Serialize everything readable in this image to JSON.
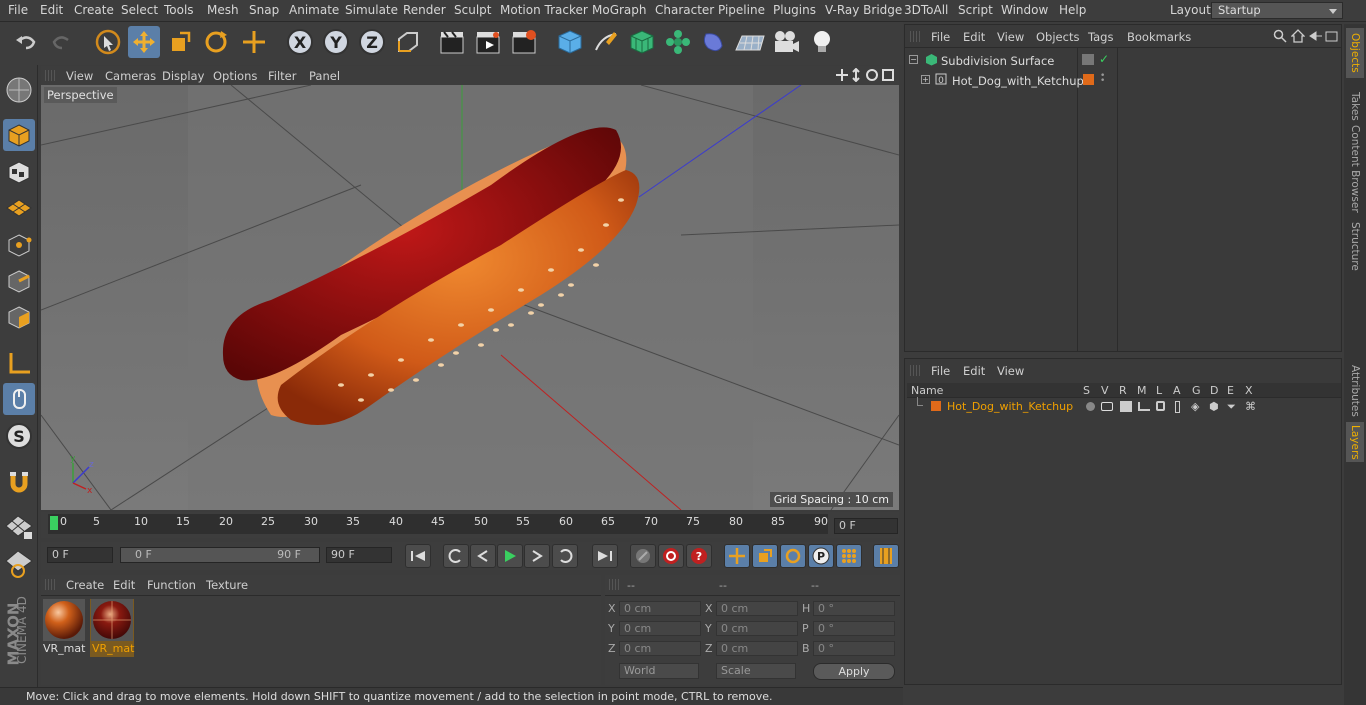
{
  "menu": [
    "File",
    "Edit",
    "Create",
    "Select",
    "Tools",
    "Mesh",
    "Snap",
    "Animate",
    "Simulate",
    "Render",
    "Sculpt",
    "Motion Tracker",
    "MoGraph",
    "Character",
    "Pipeline",
    "Plugins",
    "V-Ray Bridge",
    "3DToAll",
    "Script",
    "Window",
    "Help"
  ],
  "layout": {
    "label": "Layout:",
    "value": "Startup"
  },
  "viewport": {
    "menu": [
      "View",
      "Cameras",
      "Display",
      "Options",
      "Filter",
      "Panel"
    ],
    "label": "Perspective",
    "grid_spacing": "Grid Spacing : 10 cm"
  },
  "timeline": {
    "ticks": [
      "0",
      "5",
      "10",
      "15",
      "20",
      "25",
      "30",
      "35",
      "40",
      "45",
      "50",
      "55",
      "60",
      "65",
      "70",
      "75",
      "80",
      "85",
      "90"
    ],
    "current_frame": "0 F",
    "start_field": "0 F",
    "range_start": "0 F",
    "range_end": "90 F",
    "end_field": "90 F"
  },
  "materials": {
    "menu": [
      "Create",
      "Edit",
      "Function",
      "Texture"
    ],
    "items": [
      {
        "label": "VR_mat",
        "selected": false
      },
      {
        "label": "VR_mat",
        "selected": true
      }
    ]
  },
  "coords": {
    "headers": [
      "--",
      "--",
      "--"
    ],
    "rows": [
      {
        "l1": "X",
        "v1": "0 cm",
        "l2": "X",
        "v2": "0 cm",
        "l3": "H",
        "v3": "0 °"
      },
      {
        "l1": "Y",
        "v1": "0 cm",
        "l2": "Y",
        "v2": "0 cm",
        "l3": "P",
        "v3": "0 °"
      },
      {
        "l1": "Z",
        "v1": "0 cm",
        "l2": "Z",
        "v2": "0 cm",
        "l3": "B",
        "v3": "0 °"
      }
    ],
    "world": "World",
    "scale": "Scale",
    "apply": "Apply"
  },
  "status": "Move: Click and drag to move elements. Hold down SHIFT to quantize movement / add to the selection in point mode, CTRL to remove.",
  "object_manager": {
    "menu": [
      "File",
      "Edit",
      "View",
      "Objects",
      "Tags",
      "Bookmarks"
    ],
    "objects": [
      {
        "name": "Subdivision Surface"
      },
      {
        "name": "Hot_Dog_with_Ketchup"
      }
    ]
  },
  "layer_manager": {
    "menu": [
      "File",
      "Edit",
      "View"
    ],
    "columns": [
      "Name",
      "S",
      "V",
      "R",
      "M",
      "L",
      "A",
      "G",
      "D",
      "E",
      "X"
    ],
    "layers": [
      {
        "name": "Hot_Dog_with_Ketchup",
        "color": "#e06a1a"
      }
    ]
  },
  "right_tabs": [
    "Objects",
    "Takes",
    "Content Browser",
    "Structure",
    "Attributes",
    "Layers"
  ],
  "brand": {
    "line1": "MAXON",
    "line2": "CINEMA 4D"
  },
  "colors": {
    "accent": "#5b7fa8",
    "selected_text": "#f0a000",
    "bg": "#3d3d3d"
  }
}
